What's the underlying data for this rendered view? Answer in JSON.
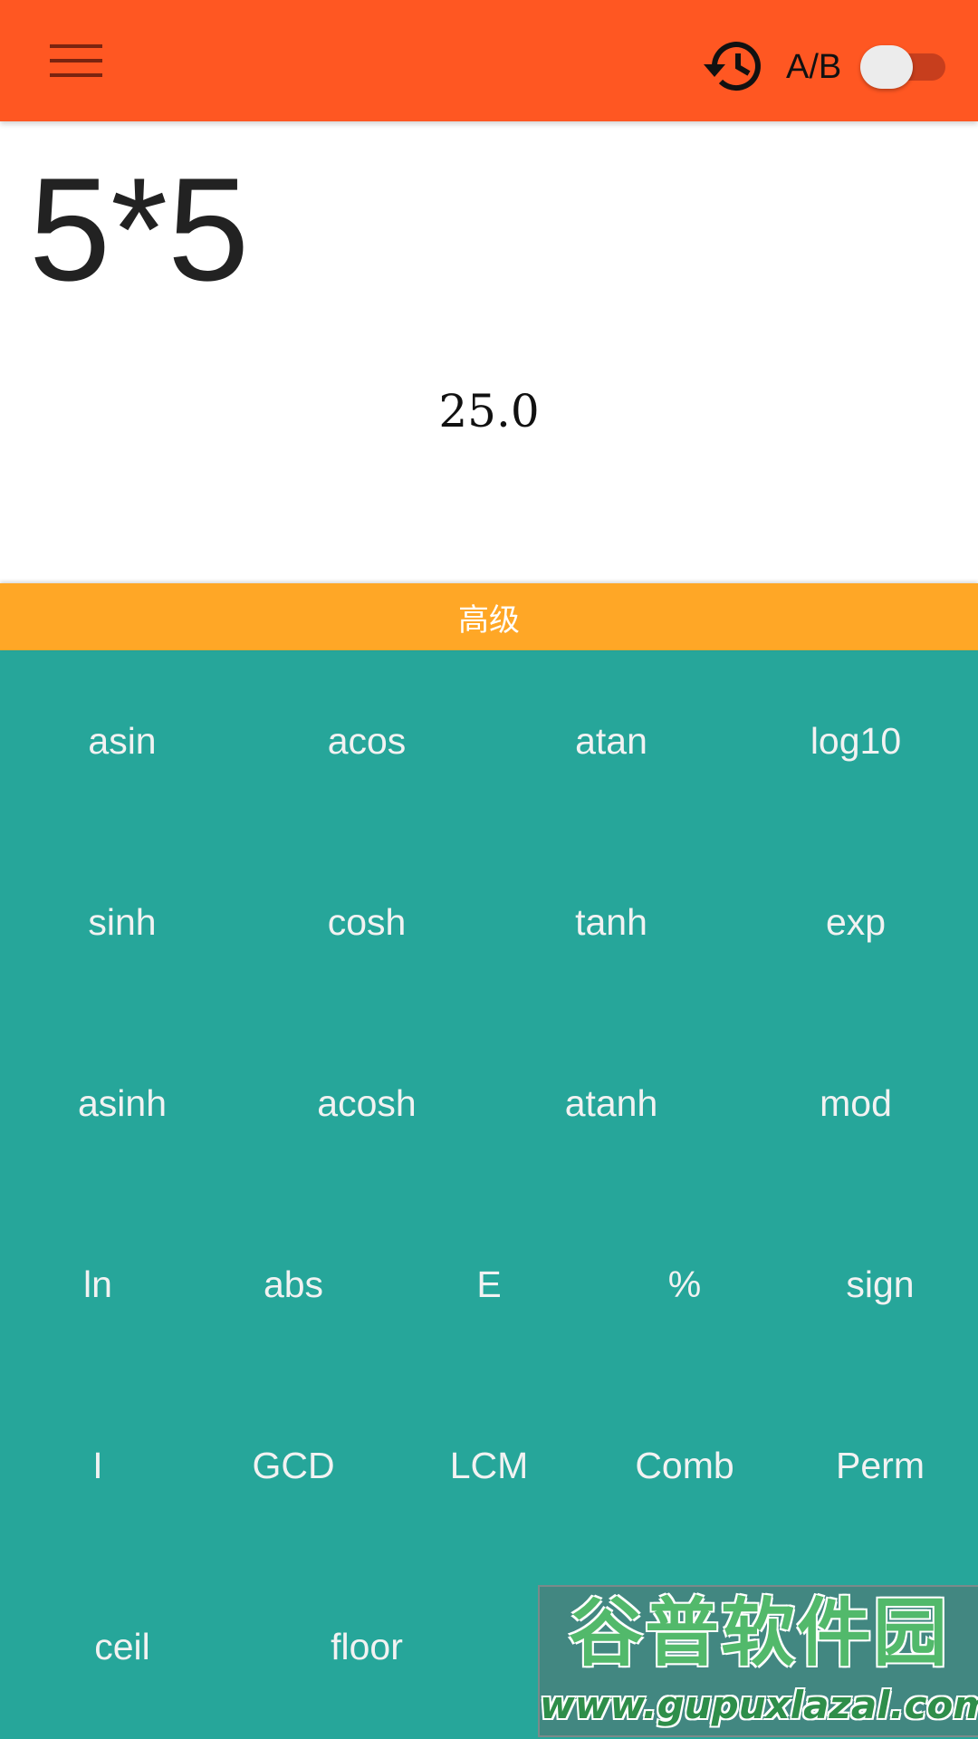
{
  "colors": {
    "appbar": "#FF5722",
    "advanced_bar": "#FFA726",
    "keypad": "#26A69A",
    "key_text": "#F2F2F2",
    "toggle_track": "#C73E1D",
    "toggle_thumb": "#ECECEC"
  },
  "appbar": {
    "menu_icon": "hamburger-menu-icon",
    "history_icon": "history-icon",
    "ab_label": "A/B",
    "toggle_state": "off"
  },
  "display": {
    "expression": "5*5",
    "result": "25.0"
  },
  "advanced_bar": {
    "label": "高级"
  },
  "keypad": {
    "rows": [
      [
        "asin",
        "acos",
        "atan",
        "log10"
      ],
      [
        "sinh",
        "cosh",
        "tanh",
        "exp"
      ],
      [
        "asinh",
        "acosh",
        "atanh",
        "mod"
      ],
      [
        "ln",
        "abs",
        "E",
        "%",
        "sign"
      ],
      [
        "I",
        "GCD",
        "LCM",
        "Comb",
        "Perm"
      ],
      [
        "ceil",
        "floor",
        "",
        ""
      ]
    ]
  },
  "watermark": {
    "title": "谷普软件园",
    "url": "www.gupuxlazal.com"
  }
}
